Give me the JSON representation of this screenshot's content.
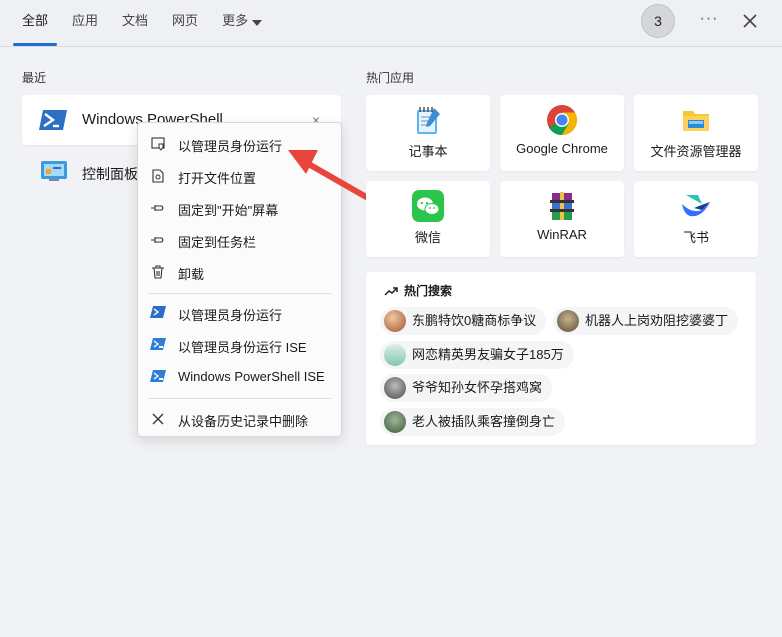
{
  "tabs": [
    {
      "label": "全部"
    },
    {
      "label": "应用"
    },
    {
      "label": "文档"
    },
    {
      "label": "网页"
    },
    {
      "label": "更多"
    }
  ],
  "header": {
    "badge": "3",
    "more_icon": "more-horizontal-icon",
    "close_icon": "close-icon"
  },
  "recent": {
    "title": "最近",
    "items": [
      {
        "label": "Windows PowerShell",
        "icon": "powershell-icon",
        "close": "×"
      },
      {
        "label": "控制面板",
        "icon": "control-panel-icon"
      }
    ]
  },
  "context_menu": {
    "items": [
      {
        "label": "以管理员身份运行",
        "icon": "shield-icon"
      },
      {
        "label": "打开文件位置",
        "icon": "file-location-icon"
      },
      {
        "label": "固定到\"开始\"屏幕",
        "icon": "pin-icon"
      },
      {
        "label": "固定到任务栏",
        "icon": "pin-icon"
      },
      {
        "label": "卸载",
        "icon": "trash-icon"
      },
      {
        "label": "以管理员身份运行",
        "icon": "powershell-icon"
      },
      {
        "label": "以管理员身份运行 ISE",
        "icon": "powershell-ise-icon"
      },
      {
        "label": "Windows PowerShell ISE",
        "icon": "powershell-ise-icon"
      },
      {
        "label": "从设备历史记录中删除",
        "icon": "close-icon"
      }
    ]
  },
  "hot_apps": {
    "title": "热门应用",
    "items": [
      {
        "label": "记事本",
        "icon": "notepad-icon"
      },
      {
        "label": "Google Chrome",
        "icon": "chrome-icon"
      },
      {
        "label": "文件资源管理器",
        "icon": "file-explorer-icon"
      },
      {
        "label": "微信",
        "icon": "wechat-icon"
      },
      {
        "label": "WinRAR",
        "icon": "winrar-icon"
      },
      {
        "label": "飞书",
        "icon": "feishu-icon"
      }
    ]
  },
  "hot_search": {
    "title": "热门搜索",
    "items": [
      {
        "label": "东鹏特饮0糖商标争议"
      },
      {
        "label": "机器人上岗劝阻挖婆婆丁"
      },
      {
        "label": "网恋精英男友骗女子185万"
      },
      {
        "label": "爷爷知孙女怀孕搭鸡窝"
      },
      {
        "label": "老人被插队乘客撞倒身亡"
      }
    ]
  },
  "colors": {
    "accent": "#1f6fd1",
    "arrow": "#e8453c",
    "background": "#f0f2f5"
  }
}
